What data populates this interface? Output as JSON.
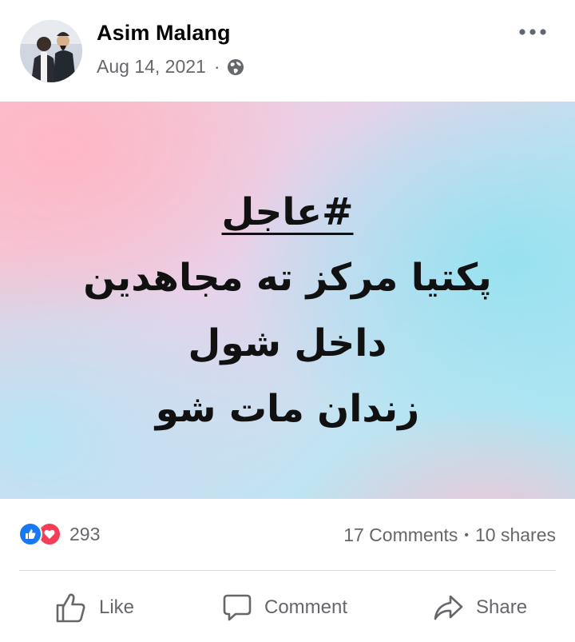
{
  "post": {
    "author": "Asim Malang",
    "date": "Aug 14, 2021",
    "separator": "·",
    "privacy_icon": "globe-icon",
    "more_icon": "more-options-icon"
  },
  "media": {
    "lines": [
      "#عاجل",
      "پکتيا مرکز ته مجاهدين",
      "داخل شول",
      "زندان مات شو"
    ]
  },
  "stats": {
    "reaction_icons": [
      "like-reaction-icon",
      "love-reaction-icon"
    ],
    "reaction_count": "293",
    "comments": "17 Comments",
    "dot": "•",
    "shares": "10 shares"
  },
  "actions": {
    "like": "Like",
    "comment": "Comment",
    "share": "Share"
  },
  "colors": {
    "like_blue": "#1877f2",
    "love_red": "#f33e58",
    "meta_gray": "#65676b"
  }
}
